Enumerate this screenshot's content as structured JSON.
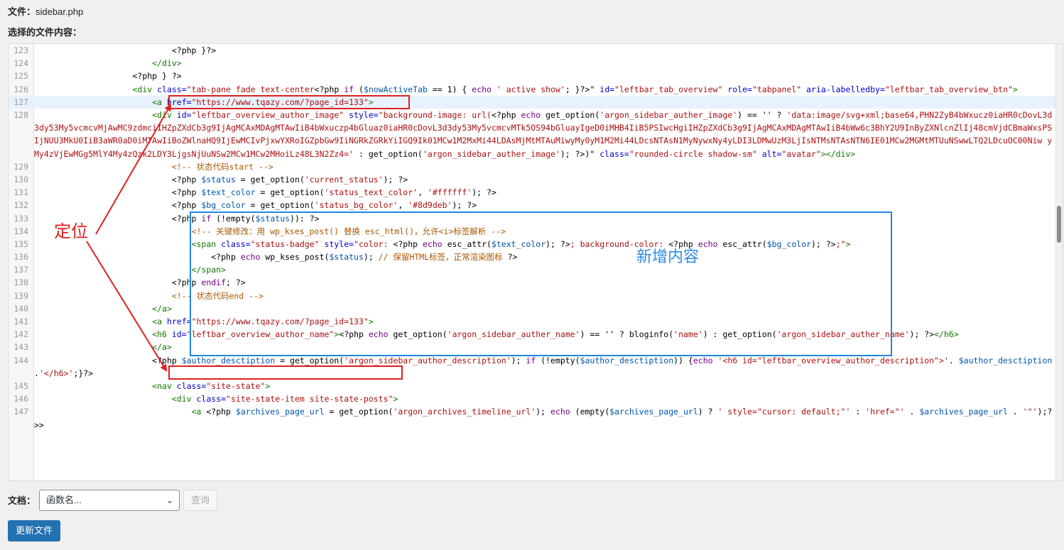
{
  "header": {
    "file_label": "文件：",
    "file_name": "sidebar.php",
    "selected_label": "选择的文件内容："
  },
  "editor": {
    "lines": [
      {
        "n": "123",
        "segs": [
          [
            "p",
            "                            <?php }?>"
          ]
        ]
      },
      {
        "n": "124",
        "segs": [
          [
            "p",
            "                        "
          ],
          [
            "tag",
            "</div>"
          ]
        ]
      },
      {
        "n": "125",
        "segs": [
          [
            "p",
            "                    <?php } ?>"
          ]
        ]
      },
      {
        "n": "126",
        "segs": [
          [
            "p",
            "                    "
          ],
          [
            "tag",
            "<div "
          ],
          [
            "attr",
            "class="
          ],
          [
            "str",
            "\"tab-pane fade text-center"
          ],
          [
            "p",
            "<?php "
          ],
          [
            "kw",
            "if"
          ],
          [
            "p",
            " ("
          ],
          [
            "var",
            "$nowActiveTab"
          ],
          [
            "p",
            " == 1) { "
          ],
          [
            "kw",
            "echo"
          ],
          [
            "str",
            " ' active show'"
          ],
          [
            "p",
            "; }?>\" "
          ],
          [
            "attr",
            "id="
          ],
          [
            "str",
            "\"leftbar_tab_overview\""
          ],
          [
            "attr",
            " role="
          ],
          [
            "str",
            "\"tabpanel\""
          ],
          [
            "attr",
            " aria-labelledby="
          ],
          [
            "str",
            "\"leftbar_tab_overview_btn\""
          ],
          [
            "tag",
            ">"
          ]
        ]
      },
      {
        "n": "127",
        "active": true,
        "segs": [
          [
            "p",
            "                        "
          ],
          [
            "tag",
            "<a "
          ],
          [
            "attr",
            "href="
          ],
          [
            "str",
            "\"https://www.tqazy.com/?page_id=133\""
          ],
          [
            "tag",
            ">"
          ]
        ]
      },
      {
        "n": "128",
        "wrap": true,
        "segs": [
          [
            "p",
            "                        "
          ],
          [
            "tag",
            "<div "
          ],
          [
            "attr",
            "id="
          ],
          [
            "str",
            "\"leftbar_overview_author_image\""
          ],
          [
            "attr",
            " style="
          ],
          [
            "str",
            "\"background-image: url("
          ],
          [
            "p",
            "<?php "
          ],
          [
            "kw",
            "echo"
          ],
          [
            "p",
            " get_option("
          ],
          [
            "str",
            "'argon_sidebar_auther_image'"
          ],
          [
            "p",
            ") == '' ? "
          ],
          [
            "str",
            "'data:image/svg+xml;base64,PHN2ZyB4bWxucz0iaHR0cDovL3d3dy53My5vcmcvMjAwMC9zdmciIHZpZXdCb3g9IjAgMCAxMDAgMTAwIiB4bWxuczp4bGluaz0iaHR0cDovL3d3dy53My5vcmcvMTk5OS94bGluayIgeD0iMHB4IiB5PSIwcHgiIHZpZXdCb3g9IjAgMCAxMDAgMTAwIiB4bWw6c3BhY2U9InByZXNlcnZlIj48cmVjdCBmaWxsPSIjNUU3MkU0IiB3aWR0aD0iMTAwIiBoZWlnaHQ9IjEwMCIvPjxwYXRoIGZpbGw9IiNGRkZGRkYiIGQ9Ik01MCw1M2MxMi44LDAsMjMtMTAuMiwyMy0yM1M2Mi44LDcsNTAsN1MyNywxNy4yLDI3LDMwUzM3LjIsNTMsNTAsNTN6IE01MCw2MGMtMTUuNSwwLTQ2LDcuOC00Niw yMy4zVjEwMGg5MlY4My4zQzk2LDY3LjgsNjUuNSw2MCw1MCw2MHoiLz48L3N2Zz4='"
          ],
          [
            "p",
            " : get_option("
          ],
          [
            "str",
            "'argon_sidebar_auther_image'"
          ],
          [
            "p",
            "); ?>)\" "
          ],
          [
            "attr",
            "class="
          ],
          [
            "str",
            "\"rounded-circle shadow-sm\""
          ],
          [
            "attr",
            " alt="
          ],
          [
            "str",
            "\"avatar\""
          ],
          [
            "tag",
            "></div>"
          ]
        ]
      },
      {
        "n": "129",
        "segs": [
          [
            "p",
            "                            "
          ],
          [
            "cmt",
            "<!-- 状态代码start -->"
          ]
        ]
      },
      {
        "n": "130",
        "segs": [
          [
            "p",
            "                            <?php "
          ],
          [
            "var",
            "$status"
          ],
          [
            "p",
            " = get_option("
          ],
          [
            "str",
            "'current_status'"
          ],
          [
            "p",
            "); ?>"
          ]
        ]
      },
      {
        "n": "131",
        "segs": [
          [
            "p",
            "                            <?php "
          ],
          [
            "var",
            "$text_color"
          ],
          [
            "p",
            " = get_option("
          ],
          [
            "str",
            "'status_text_color'"
          ],
          [
            "p",
            ", "
          ],
          [
            "str",
            "'#ffffff'"
          ],
          [
            "p",
            "); ?>"
          ]
        ]
      },
      {
        "n": "132",
        "segs": [
          [
            "p",
            "                            <?php "
          ],
          [
            "var",
            "$bg_color"
          ],
          [
            "p",
            " = get_option("
          ],
          [
            "str",
            "'status_bg_color'"
          ],
          [
            "p",
            ", "
          ],
          [
            "str",
            "'#8d9deb'"
          ],
          [
            "p",
            "); ?>"
          ]
        ]
      },
      {
        "n": "133",
        "segs": [
          [
            "p",
            "                            <?php "
          ],
          [
            "kw",
            "if"
          ],
          [
            "p",
            " (!empty("
          ],
          [
            "var",
            "$status"
          ],
          [
            "p",
            ")): ?>"
          ]
        ]
      },
      {
        "n": "134",
        "segs": [
          [
            "p",
            "                                "
          ],
          [
            "cmt",
            "<!-- 关键修改：用 wp_kses_post() 替换 esc_html()，允许<i>标签解析 -->"
          ]
        ]
      },
      {
        "n": "135",
        "segs": [
          [
            "p",
            "                                "
          ],
          [
            "tag",
            "<span "
          ],
          [
            "attr",
            "class="
          ],
          [
            "str",
            "\"status-badge\""
          ],
          [
            "attr",
            " style="
          ],
          [
            "str",
            "\"color: "
          ],
          [
            "p",
            "<?php "
          ],
          [
            "kw",
            "echo"
          ],
          [
            "p",
            " esc_attr("
          ],
          [
            "var",
            "$text_color"
          ],
          [
            "p",
            "); ?>"
          ],
          [
            "str",
            "; background-color: "
          ],
          [
            "p",
            "<?php "
          ],
          [
            "kw",
            "echo"
          ],
          [
            "p",
            " esc_attr("
          ],
          [
            "var",
            "$bg_color"
          ],
          [
            "p",
            "); ?>"
          ],
          [
            "str",
            ";\""
          ],
          [
            "tag",
            ">"
          ]
        ]
      },
      {
        "n": "136",
        "segs": [
          [
            "p",
            "                                    <?php "
          ],
          [
            "kw",
            "echo"
          ],
          [
            "p",
            " wp_kses_post("
          ],
          [
            "var",
            "$status"
          ],
          [
            "p",
            "); "
          ],
          [
            "cmt",
            "// 保留HTML标签，正常渲染图标"
          ],
          [
            "p",
            " ?>"
          ]
        ]
      },
      {
        "n": "137",
        "segs": [
          [
            "p",
            "                                "
          ],
          [
            "tag",
            "</span>"
          ]
        ]
      },
      {
        "n": "138",
        "segs": [
          [
            "p",
            "                            <?php "
          ],
          [
            "kw",
            "endif"
          ],
          [
            "p",
            "; ?>"
          ]
        ]
      },
      {
        "n": "139",
        "segs": [
          [
            "p",
            "                            "
          ],
          [
            "cmt",
            "<!-- 状态代码end -->"
          ]
        ]
      },
      {
        "n": "140",
        "segs": [
          [
            "p",
            "                        "
          ],
          [
            "tag",
            "</a>"
          ]
        ]
      },
      {
        "n": "141",
        "segs": [
          [
            "p",
            "                        "
          ],
          [
            "tag",
            "<a "
          ],
          [
            "attr",
            "href="
          ],
          [
            "str",
            "\"https://www.tqazy.com/?page_id=133\""
          ],
          [
            "tag",
            ">"
          ]
        ]
      },
      {
        "n": "142",
        "segs": [
          [
            "p",
            "                        "
          ],
          [
            "tag",
            "<h6 "
          ],
          [
            "attr",
            "id="
          ],
          [
            "str",
            "\"leftbar_overview_author_name\""
          ],
          [
            "tag",
            ">"
          ],
          [
            "p",
            "<?php "
          ],
          [
            "kw",
            "echo"
          ],
          [
            "p",
            " get_option("
          ],
          [
            "str",
            "'argon_sidebar_auther_name'"
          ],
          [
            "p",
            ") == '' ? bloginfo("
          ],
          [
            "str",
            "'name'"
          ],
          [
            "p",
            ") : get_option("
          ],
          [
            "str",
            "'argon_sidebar_auther_name'"
          ],
          [
            "p",
            "); ?>"
          ],
          [
            "tag",
            "</h6>"
          ]
        ]
      },
      {
        "n": "143",
        "segs": [
          [
            "p",
            "                        "
          ],
          [
            "tag",
            "</a>"
          ]
        ]
      },
      {
        "n": "144",
        "wrap": true,
        "segs": [
          [
            "p",
            "                        <?php "
          ],
          [
            "var",
            "$author_desctiption"
          ],
          [
            "p",
            " = get_option("
          ],
          [
            "str",
            "'argon_sidebar_author_description'"
          ],
          [
            "p",
            "); "
          ],
          [
            "kw",
            "if"
          ],
          [
            "p",
            " (!empty("
          ],
          [
            "var",
            "$author_desctiption"
          ],
          [
            "p",
            ")) {"
          ],
          [
            "kw",
            "echo"
          ],
          [
            "str",
            " '<h6 id=\"leftbar_overview_author_description\">'"
          ],
          [
            "p",
            ". "
          ],
          [
            "var",
            "$author_desctiption"
          ],
          [
            "p",
            " ."
          ],
          [
            "str",
            "'</h6>'"
          ],
          [
            "p",
            ";}?>"
          ]
        ]
      },
      {
        "n": "145",
        "segs": [
          [
            "p",
            "                        "
          ],
          [
            "tag",
            "<nav "
          ],
          [
            "attr",
            "class="
          ],
          [
            "str",
            "\"site-state\""
          ],
          [
            "tag",
            ">"
          ]
        ]
      },
      {
        "n": "146",
        "segs": [
          [
            "p",
            "                            "
          ],
          [
            "tag",
            "<div "
          ],
          [
            "attr",
            "class="
          ],
          [
            "str",
            "\"site-state-item site-state-posts\""
          ],
          [
            "tag",
            ">"
          ]
        ]
      },
      {
        "n": "147",
        "wrap": true,
        "segs": [
          [
            "p",
            "                                "
          ],
          [
            "tag",
            "<a "
          ],
          [
            "p",
            "<?php "
          ],
          [
            "var",
            "$archives_page_url"
          ],
          [
            "p",
            " = get_option("
          ],
          [
            "str",
            "'argon_archives_timeline_url'"
          ],
          [
            "p",
            "); "
          ],
          [
            "kw",
            "echo"
          ],
          [
            "p",
            " (empty("
          ],
          [
            "var",
            "$archives_page_url"
          ],
          [
            "p",
            ") ? "
          ],
          [
            "str",
            "' style=\"cursor: default;\"'"
          ],
          [
            "p",
            " : "
          ],
          [
            "str",
            "'href=\"'"
          ],
          [
            "p",
            " . "
          ],
          [
            "var",
            "$archives_page_url"
          ],
          [
            "p",
            " . "
          ],
          [
            "str",
            "'\"'"
          ],
          [
            "p",
            ");?>>"
          ]
        ]
      }
    ]
  },
  "annotations": {
    "locate_label": "定位",
    "new_content_label": "新增内容"
  },
  "footer": {
    "doc_label": "文档：",
    "select_value": "函数名...",
    "query_label": "查询",
    "update_label": "更新文件"
  },
  "colors": {
    "annotation_red": "#e02020",
    "annotation_blue": "#1e88e5",
    "primary_button": "#2271b1"
  }
}
